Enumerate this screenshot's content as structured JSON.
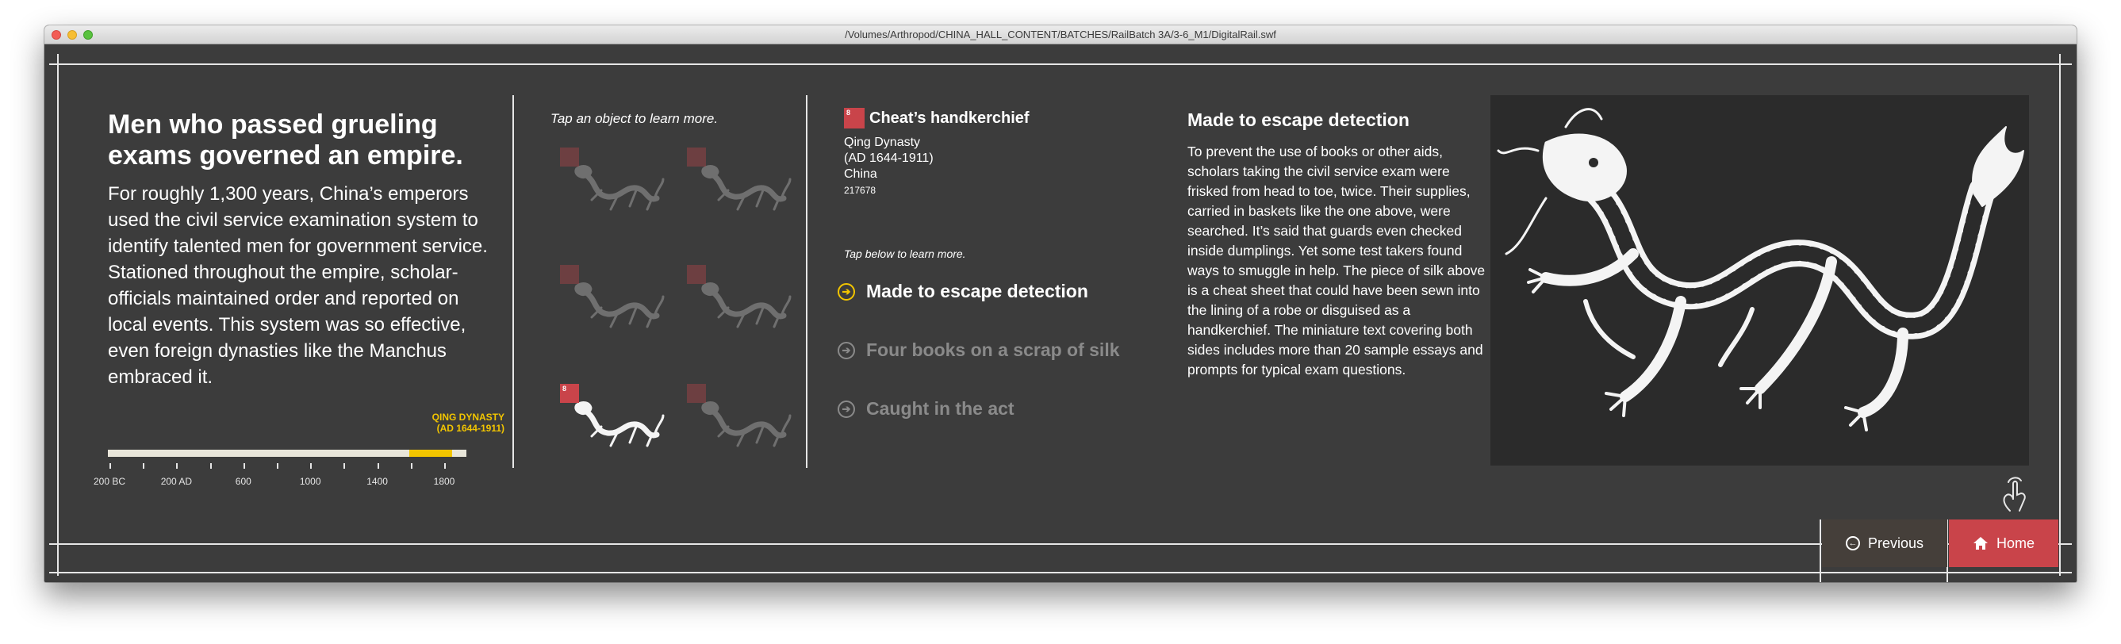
{
  "window": {
    "title": "/Volumes/Arthropod/CHINA_HALL_CONTENT/BATCHES/RailBatch 3A/3-6_M1/DigitalRail.swf"
  },
  "intro": {
    "heading": "Men who passed grueling exams governed an empire.",
    "body": "For roughly 1,300 years, China’s emperors used the civil service examination system to identify talented men for government service. Stationed throughout the empire, scholar-officials maintained order and reported on local events. This system was so effective, even foreign dynasties like the Manchus embraced it."
  },
  "timeline": {
    "era_name": "QING DYNASTY",
    "era_range": "(AD 1644-1911)",
    "tick_labels": [
      "200 BC",
      "200 AD",
      "600",
      "1000",
      "1400",
      "1800"
    ],
    "era_start_fraction": 0.84,
    "era_end_fraction": 0.96,
    "highlight_color": "#f2c500"
  },
  "objects": {
    "instruction": "Tap an object to learn more.",
    "thumbnails": [
      {
        "badge": "",
        "icon": "dragon-icon",
        "selected": false
      },
      {
        "badge": "",
        "icon": "dragon-icon",
        "selected": false
      },
      {
        "badge": "",
        "icon": "dragon-icon",
        "selected": false
      },
      {
        "badge": "",
        "icon": "dragon-icon",
        "selected": false
      },
      {
        "badge": "8",
        "icon": "dragon-icon",
        "selected": true
      },
      {
        "badge": "",
        "icon": "dragon-icon",
        "selected": false
      }
    ]
  },
  "selected_object": {
    "badge": "8",
    "title": "Cheat’s handkerchief",
    "dynasty": "Qing Dynasty",
    "dates": "(AD 1644-1911)",
    "place": "China",
    "catalog_number": "217678",
    "instruction": "Tap below to learn more.",
    "stories": [
      {
        "label": "Made to escape detection",
        "active": true
      },
      {
        "label": "Four books on a scrap of silk",
        "active": false
      },
      {
        "label": "Caught in the act",
        "active": false
      }
    ]
  },
  "detail": {
    "title": "Made to escape detection",
    "body": "To prevent the use of books or other aids, scholars taking the civil service exam were frisked from head to toe, twice. Their supplies, carried in baskets like the one above, were searched. It’s said that guards even checked inside dumplings. Yet some test takers found ways to smuggle in help. The piece of silk above is a cheat sheet that could have been sewn into the lining of a robe or disguised as a handkerchief. The miniature text covering both sides includes more than 20 sample essays and prompts for typical exam questions.",
    "image_icon": "dragon-icon"
  },
  "nav": {
    "previous_label": "Previous",
    "home_label": "Home",
    "previous_icon": "arrow-left-circle-icon",
    "home_icon": "home-icon",
    "accent": "#c9444a"
  },
  "colors": {
    "stage_bg": "#3c3c3c",
    "highlight": "#f2c500",
    "badge": "#c9444a"
  }
}
